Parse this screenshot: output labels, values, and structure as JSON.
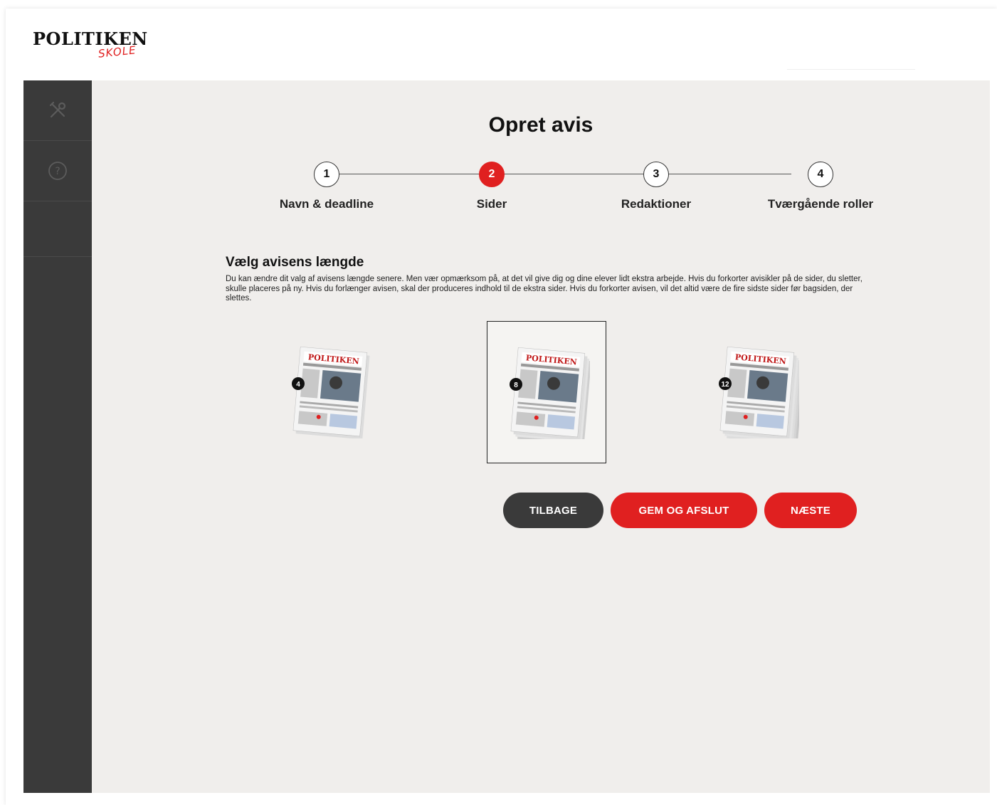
{
  "brand": {
    "name": "POLITIKEN",
    "sub": "SKOLE"
  },
  "page_title": "Opret avis",
  "steps": [
    {
      "number": "1",
      "label": "Navn & deadline"
    },
    {
      "number": "2",
      "label": "Sider"
    },
    {
      "number": "3",
      "label": "Redaktioner"
    },
    {
      "number": "4",
      "label": "Tværgående roller"
    }
  ],
  "active_step": 2,
  "section": {
    "title": "Vælg avisens længde",
    "text": "Du kan ændre dit valg af avisens længde senere. Men vær opmærksom på, at det vil give dig og dine elever lidt ekstra arbejde. Hvis du forkorter avisikler på de sider, du sletter, skulle placeres på ny. Hvis du forlænger avisen, skal der produceres indhold til de ekstra sider. Hvis du forkorter avisen, vil det altid være de fire sidste sider før bagsiden, der slettes."
  },
  "length_options": [
    {
      "pages": "4",
      "masthead": "POLITIKEN",
      "selected": false
    },
    {
      "pages": "8",
      "masthead": "POLITIKEN",
      "selected": true
    },
    {
      "pages": "12",
      "masthead": "POLITIKEN",
      "selected": false
    }
  ],
  "buttons": {
    "back": "TILBAGE",
    "save": "GEM OG AFSLUT",
    "next": "NÆSTE"
  },
  "sidebar": [
    {
      "icon": "tools-icon"
    },
    {
      "icon": "help-icon"
    }
  ],
  "colors": {
    "accent": "#e02020",
    "dark": "#3a3a3a",
    "background": "#f0eeec"
  }
}
